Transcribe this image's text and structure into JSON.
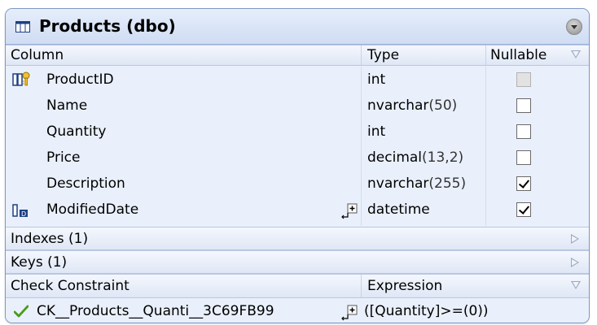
{
  "title": "Products (dbo)",
  "headers": {
    "column": "Column",
    "type": "Type",
    "nullable": "Nullable",
    "indexes": "Indexes (1)",
    "keys": "Keys (1)",
    "check_constraint": "Check Constraint",
    "expression": "Expression"
  },
  "rows": [
    {
      "name": "ProductID",
      "type": "int",
      "type_size": "",
      "nullable": false,
      "nullable_disabled": true
    },
    {
      "name": "Name",
      "type": "nvarchar",
      "type_size": "(50)",
      "nullable": false,
      "nullable_disabled": false
    },
    {
      "name": "Quantity",
      "type": "int",
      "type_size": "",
      "nullable": false,
      "nullable_disabled": false
    },
    {
      "name": "Price",
      "type": "decimal",
      "type_size": "(13,2)",
      "nullable": false,
      "nullable_disabled": false
    },
    {
      "name": "Description",
      "type": "nvarchar",
      "type_size": "(255)",
      "nullable": true,
      "nullable_disabled": false
    },
    {
      "name": "ModifiedDate",
      "type": "datetime",
      "type_size": "",
      "nullable": true,
      "nullable_disabled": false
    }
  ],
  "constraint": {
    "name": "CK__Products__Quanti__3C69FB99",
    "expression": "([Quantity]>=(0))"
  },
  "colors": {
    "panel_bg": "#e9f0fb",
    "border": "#7d99c6",
    "check_green": "#4a9b1a"
  }
}
